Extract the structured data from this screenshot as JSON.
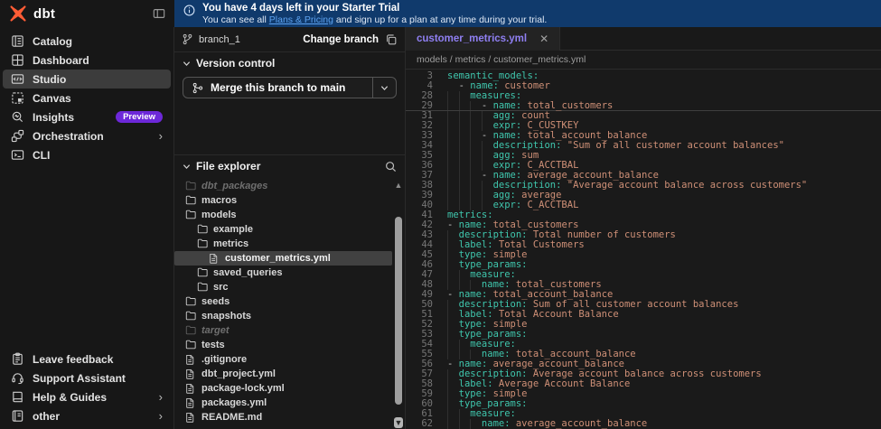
{
  "topbar": {
    "logo_text": "dbt",
    "banner": {
      "title": "You have 4 days left in your Starter Trial",
      "body_prefix": "You can see all ",
      "link_label": "Plans & Pricing",
      "body_suffix": " and sign up for a plan at any time during your trial."
    }
  },
  "sidebar": {
    "items": [
      {
        "id": "catalog",
        "label": "Catalog",
        "icon": "catalog-icon"
      },
      {
        "id": "dashboard",
        "label": "Dashboard",
        "icon": "dashboard-icon"
      },
      {
        "id": "studio",
        "label": "Studio",
        "icon": "studio-icon",
        "selected": true
      },
      {
        "id": "canvas",
        "label": "Canvas",
        "icon": "canvas-icon"
      },
      {
        "id": "insights",
        "label": "Insights",
        "icon": "insights-icon",
        "badge": "Preview"
      },
      {
        "id": "orchestration",
        "label": "Orchestration",
        "icon": "orchestration-icon",
        "chevron": true
      },
      {
        "id": "cli",
        "label": "CLI",
        "icon": "cli-icon"
      }
    ],
    "bottom_items": [
      {
        "id": "leave-feedback",
        "label": "Leave feedback",
        "icon": "feedback-icon"
      },
      {
        "id": "support-assistant",
        "label": "Support Assistant",
        "icon": "headset-icon"
      },
      {
        "id": "help-guides",
        "label": "Help & Guides",
        "icon": "book-icon",
        "chevron": true
      },
      {
        "id": "other",
        "label": "other",
        "icon": "other-icon",
        "chevron": true
      }
    ]
  },
  "middle": {
    "branch": {
      "name": "branch_1",
      "change_label": "Change branch"
    },
    "version_control": {
      "title": "Version control",
      "merge_label": "Merge this branch to main"
    },
    "file_explorer": {
      "title": "File explorer",
      "items": [
        {
          "label": "dbt_packages",
          "type": "folder",
          "depth": 0,
          "muted": true
        },
        {
          "label": "macros",
          "type": "folder",
          "depth": 0
        },
        {
          "label": "models",
          "type": "folder",
          "depth": 0
        },
        {
          "label": "example",
          "type": "folder",
          "depth": 1
        },
        {
          "label": "metrics",
          "type": "folder",
          "depth": 1
        },
        {
          "label": "customer_metrics.yml",
          "type": "file",
          "depth": 2,
          "selected": true
        },
        {
          "label": "saved_queries",
          "type": "folder",
          "depth": 1
        },
        {
          "label": "src",
          "type": "folder",
          "depth": 1
        },
        {
          "label": "seeds",
          "type": "folder",
          "depth": 0
        },
        {
          "label": "snapshots",
          "type": "folder",
          "depth": 0
        },
        {
          "label": "target",
          "type": "folder",
          "depth": 0,
          "muted": true
        },
        {
          "label": "tests",
          "type": "folder",
          "depth": 0
        },
        {
          "label": ".gitignore",
          "type": "file",
          "depth": 0
        },
        {
          "label": "dbt_project.yml",
          "type": "file",
          "depth": 0
        },
        {
          "label": "package-lock.yml",
          "type": "file",
          "depth": 0
        },
        {
          "label": "packages.yml",
          "type": "file",
          "depth": 0
        },
        {
          "label": "README.md",
          "type": "file",
          "depth": 0
        }
      ]
    }
  },
  "editor": {
    "tab_label": "customer_metrics.yml",
    "tab_close_glyph": "✕",
    "breadcrumb": "models / metrics / customer_metrics.yml",
    "code_lines": [
      {
        "n": 3,
        "ind": 0,
        "dash": false,
        "key": "semantic_models",
        "val": ""
      },
      {
        "n": 4,
        "ind": 2,
        "dash": true,
        "key": "name",
        "val": "customer"
      },
      {
        "n": 28,
        "ind": 4,
        "dash": false,
        "key": "measures",
        "val": ""
      },
      {
        "n": 29,
        "ind": 6,
        "dash": true,
        "key": "name",
        "val": "total_customers",
        "fold_after": true
      },
      {
        "n": 31,
        "ind": 8,
        "dash": false,
        "key": "agg",
        "val": "count"
      },
      {
        "n": 32,
        "ind": 8,
        "dash": false,
        "key": "expr",
        "val": "C_CUSTKEY"
      },
      {
        "n": 33,
        "ind": 6,
        "dash": true,
        "key": "name",
        "val": "total_account_balance"
      },
      {
        "n": 34,
        "ind": 8,
        "dash": false,
        "key": "description",
        "val": "\"Sum of all customer account balances\""
      },
      {
        "n": 35,
        "ind": 8,
        "dash": false,
        "key": "agg",
        "val": "sum"
      },
      {
        "n": 36,
        "ind": 8,
        "dash": false,
        "key": "expr",
        "val": "C_ACCTBAL"
      },
      {
        "n": 37,
        "ind": 6,
        "dash": true,
        "key": "name",
        "val": "average_account_balance"
      },
      {
        "n": 38,
        "ind": 8,
        "dash": false,
        "key": "description",
        "val": "\"Average account balance across customers\""
      },
      {
        "n": 39,
        "ind": 8,
        "dash": false,
        "key": "agg",
        "val": "average"
      },
      {
        "n": 40,
        "ind": 8,
        "dash": false,
        "key": "expr",
        "val": "C_ACCTBAL"
      },
      {
        "n": 41,
        "ind": 0,
        "dash": false,
        "key": "metrics",
        "val": ""
      },
      {
        "n": 42,
        "ind": 0,
        "dash": true,
        "key": "name",
        "val": "total_customers"
      },
      {
        "n": 43,
        "ind": 2,
        "dash": false,
        "key": "description",
        "val": "Total number of customers"
      },
      {
        "n": 44,
        "ind": 2,
        "dash": false,
        "key": "label",
        "val": "Total Customers"
      },
      {
        "n": 45,
        "ind": 2,
        "dash": false,
        "key": "type",
        "val": "simple"
      },
      {
        "n": 46,
        "ind": 2,
        "dash": false,
        "key": "type_params",
        "val": ""
      },
      {
        "n": 47,
        "ind": 4,
        "dash": false,
        "key": "measure",
        "val": ""
      },
      {
        "n": 48,
        "ind": 6,
        "dash": false,
        "key": "name",
        "val": "total_customers"
      },
      {
        "n": 49,
        "ind": 0,
        "dash": true,
        "key": "name",
        "val": "total_account_balance"
      },
      {
        "n": 50,
        "ind": 2,
        "dash": false,
        "key": "description",
        "val": "Sum of all customer account balances"
      },
      {
        "n": 51,
        "ind": 2,
        "dash": false,
        "key": "label",
        "val": "Total Account Balance"
      },
      {
        "n": 52,
        "ind": 2,
        "dash": false,
        "key": "type",
        "val": "simple"
      },
      {
        "n": 53,
        "ind": 2,
        "dash": false,
        "key": "type_params",
        "val": ""
      },
      {
        "n": 54,
        "ind": 4,
        "dash": false,
        "key": "measure",
        "val": ""
      },
      {
        "n": 55,
        "ind": 6,
        "dash": false,
        "key": "name",
        "val": "total_account_balance"
      },
      {
        "n": 56,
        "ind": 0,
        "dash": true,
        "key": "name",
        "val": "average_account_balance"
      },
      {
        "n": 57,
        "ind": 2,
        "dash": false,
        "key": "description",
        "val": "Average account balance across customers"
      },
      {
        "n": 58,
        "ind": 2,
        "dash": false,
        "key": "label",
        "val": "Average Account Balance"
      },
      {
        "n": 59,
        "ind": 2,
        "dash": false,
        "key": "type",
        "val": "simple"
      },
      {
        "n": 60,
        "ind": 2,
        "dash": false,
        "key": "type_params",
        "val": ""
      },
      {
        "n": 61,
        "ind": 4,
        "dash": false,
        "key": "measure",
        "val": ""
      },
      {
        "n": 62,
        "ind": 6,
        "dash": false,
        "key": "name",
        "val": "average_account_balance"
      }
    ]
  },
  "colors": {
    "banner_bg": "#103a6c",
    "link": "#5ca2f0",
    "preview_badge": "#6d28d9",
    "logo_orange": "#ff5c35",
    "tab_label": "#8f7ff2",
    "yaml_key": "#3fc6ad",
    "yaml_value": "#cf9077"
  }
}
